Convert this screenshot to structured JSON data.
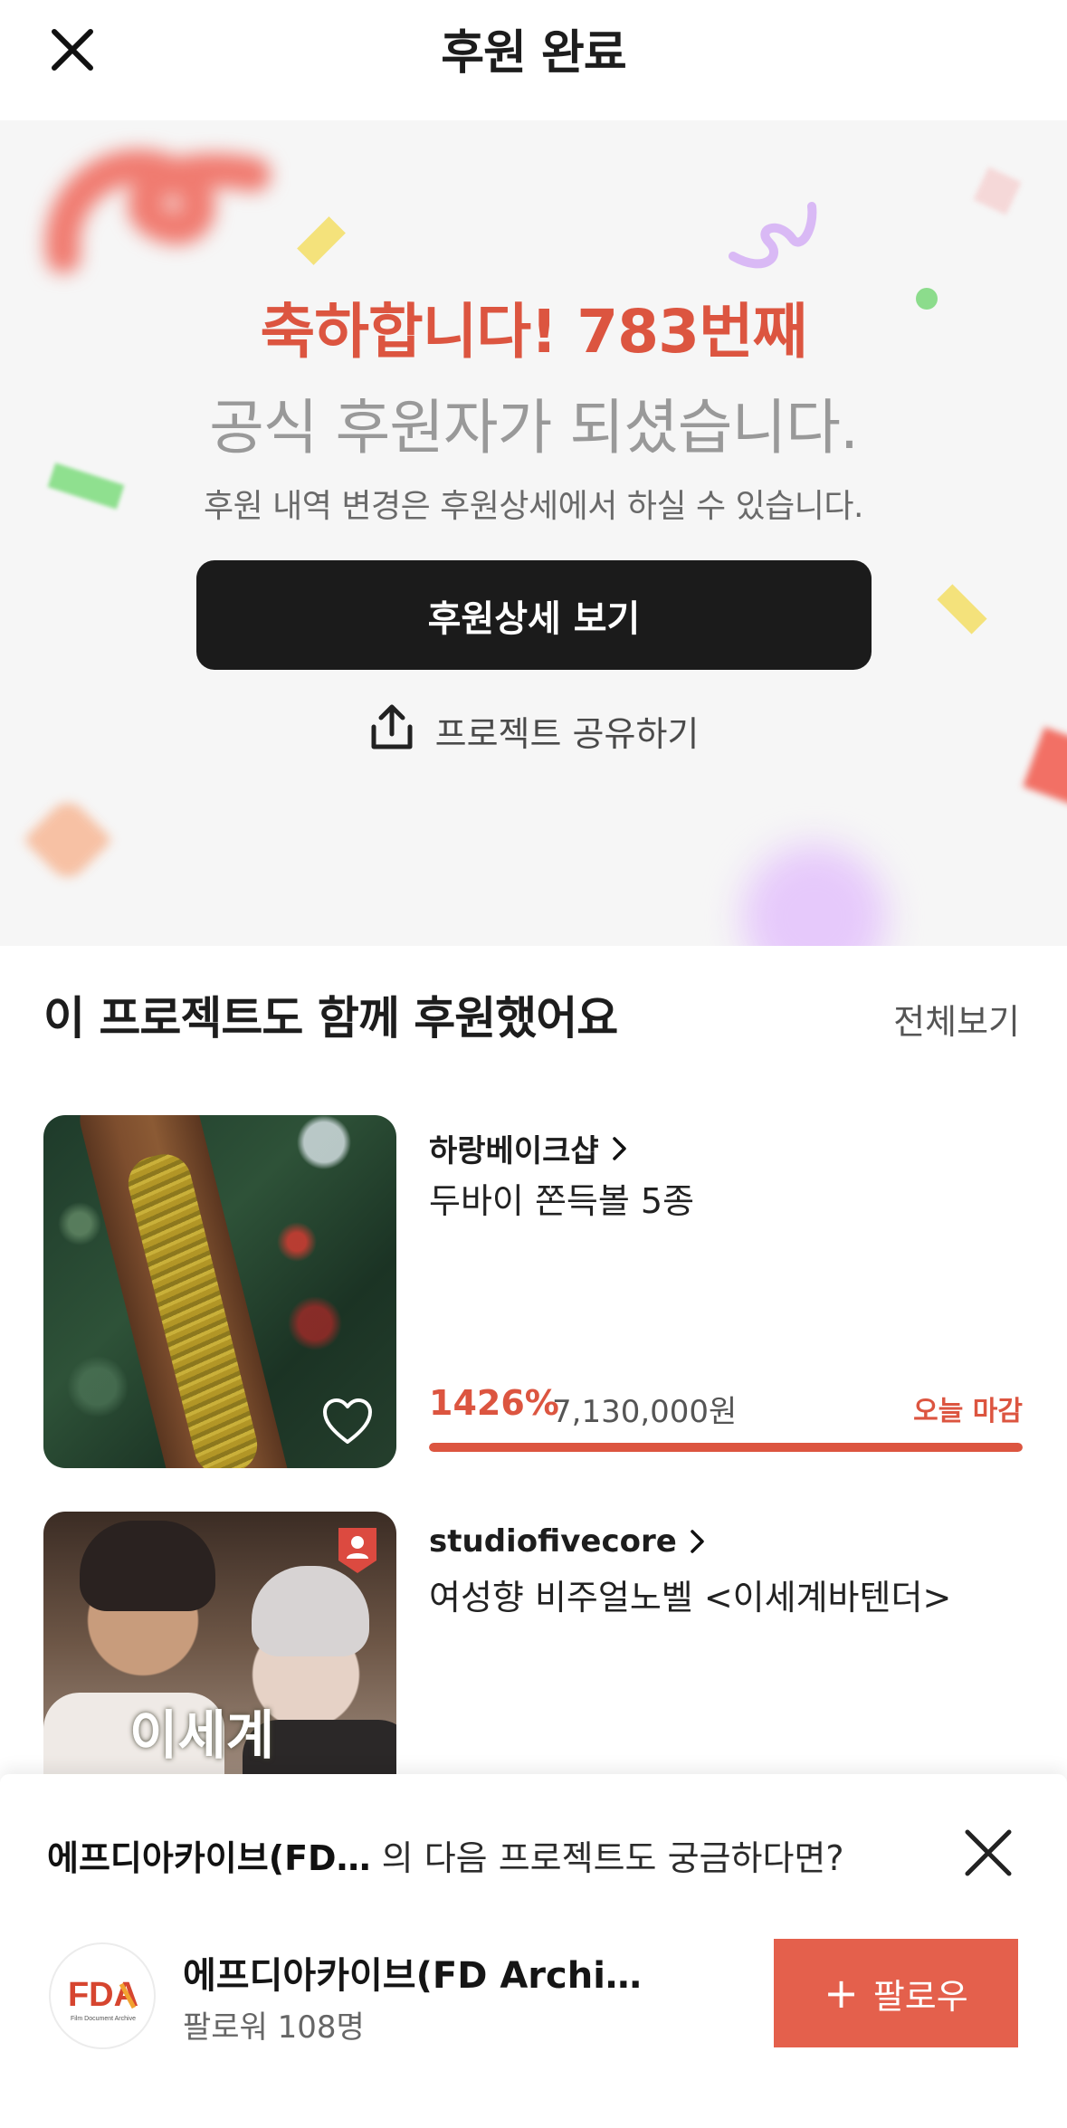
{
  "header": {
    "title": "후원 완료"
  },
  "hero": {
    "congrats": "축하합니다! 783번째",
    "official": "공식 후원자가 되셨습니다.",
    "notice": "후원 내역 변경은 후원상세에서 하실 수 있습니다.",
    "detail_button": "후원상세 보기",
    "share_label": "프로젝트 공유하기"
  },
  "section": {
    "title": "이 프로젝트도 함께 후원했어요",
    "see_all": "전체보기"
  },
  "projects": [
    {
      "seller": "하랑베이크샵",
      "title": "두바이 쫀득볼 5종",
      "percent": "1426%",
      "amount": "7,130,000원",
      "deadline": "오늘 마감",
      "progress_fraction": 1.0
    },
    {
      "seller": "studiofivecore",
      "title": "여성향 비주얼노벨 <이세계바텐더>",
      "thumbnail_text": "이세계"
    }
  ],
  "sheet": {
    "creator_short": "에프디아카이브(FD…",
    "question_suffix": " 의 다음 프로젝트도 궁금하다면?",
    "creator_name": "에프디아카이브(FD Archi…",
    "followers": "팔로워 108명",
    "follow_label": "팔로우",
    "avatar_logo_text": "FDA",
    "avatar_logo_caption": "Film Document Archive"
  },
  "colors": {
    "accent": "#dc5540",
    "follow_button": "#e4604c",
    "dark_button": "#1b1b1b",
    "hero_bg": "#f6f6f6"
  }
}
